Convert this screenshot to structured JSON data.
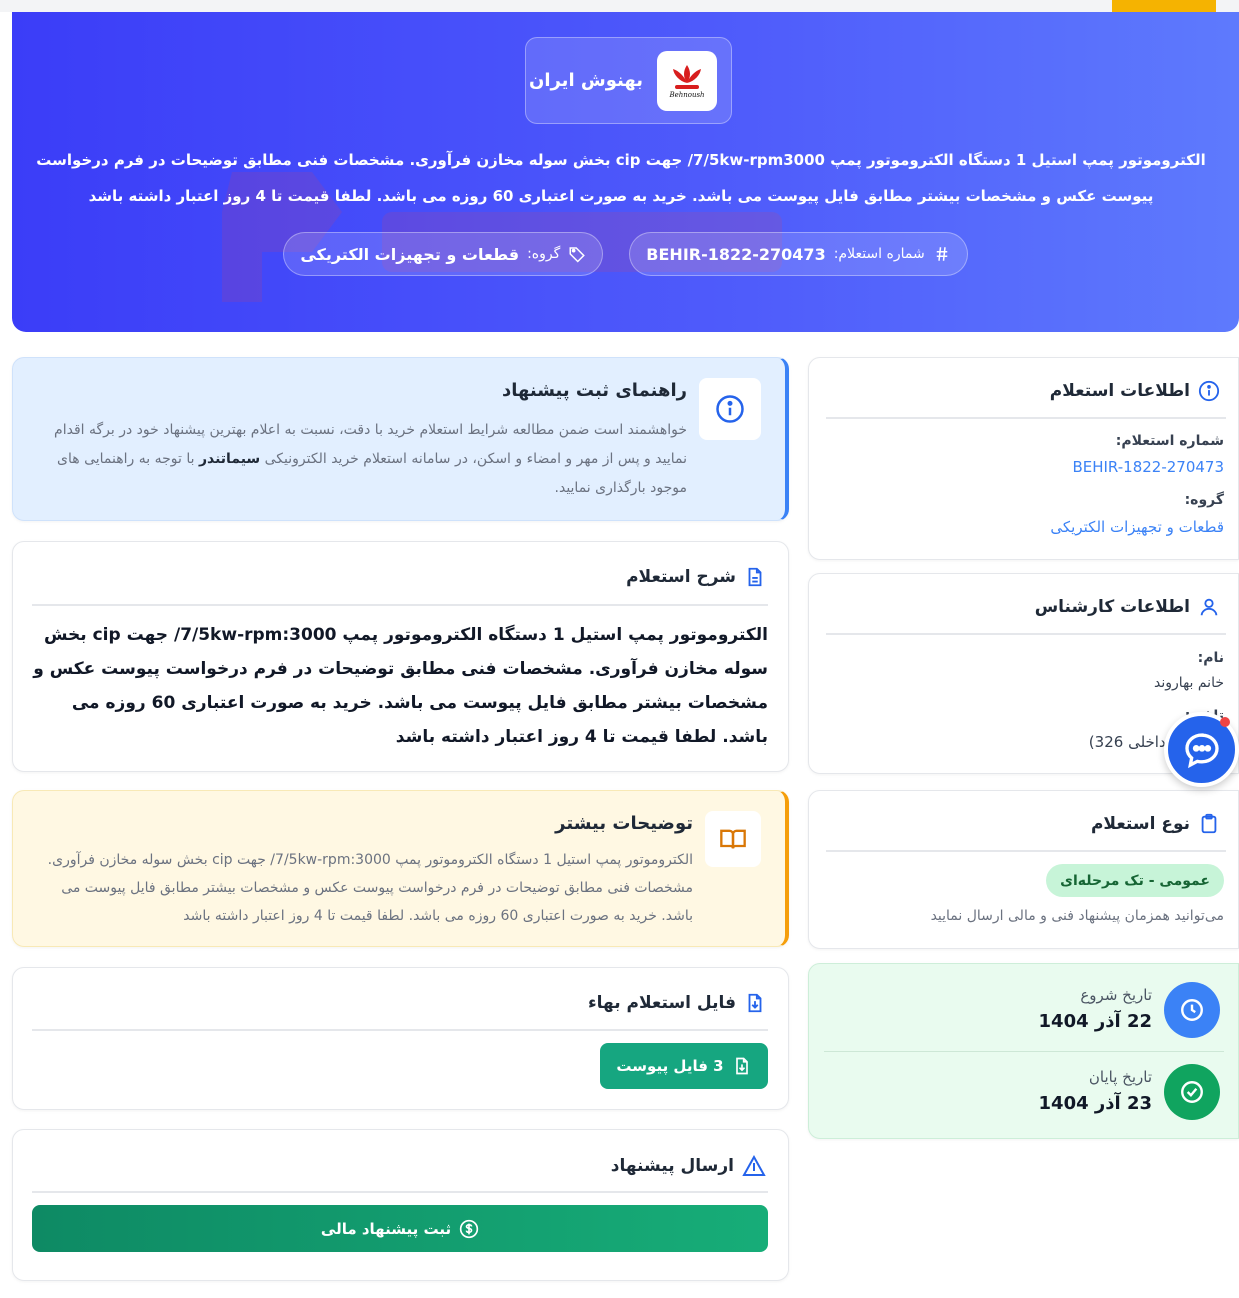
{
  "hero": {
    "org_name": "بهنوش ایران",
    "logo_text": "Behnoush",
    "description": "الکتروموتور پمپ استیل 1 دستگاه الکتروموتور پمپ 7/5kw-rpm3000/ جهت cip بخش سوله مخازن فرآوری. مشخصات فنی مطابق توضیحات در فرم درخواست پیوست عکس و مشخصات بیشتر مطابق فایل پیوست می باشد. خرید به صورت اعتباری 60 روزه می باشد. لطفا قیمت تا 4 روز اعتبار داشته باشد",
    "inquiry_label": "شماره استعلام:",
    "inquiry_value": "BEHIR-1822-270473",
    "group_label": "گروه:",
    "group_value": "قطعات و تجهیزات الکتریکی"
  },
  "guide": {
    "title": "راهنمای ثبت پیشنهاد",
    "text_before": "خواهشمند است ضمن مطالعه شرایط استعلام خرید با دقت، نسبت به اعلام بهترین پیشنهاد خود در برگه اقدام نمایید و پس از مهر و امضاء و اسکن، در سامانه استعلام خرید الکترونیکی ",
    "brand": "سیماتندر",
    "text_after": " با توجه به راهنمایی های موجود بارگذاری نمایید."
  },
  "description_card": {
    "title": "شرح استعلام",
    "body": "الکتروموتور پمپ استیل 1 دستگاه الکتروموتور پمپ 7/5kw-rpm:3000/ جهت cip بخش سوله مخازن فرآوری. مشخصات فنی مطابق توضیحات در فرم درخواست پیوست عکس و مشخصات بیشتر مطابق فایل پیوست می باشد. خرید به صورت اعتباری 60 روزه می باشد. لطفا قیمت تا 4 روز اعتبار داشته باشد"
  },
  "more_card": {
    "title": "توضیحات بیشتر",
    "body": "الکتروموتور پمپ استیل 1 دستگاه الکتروموتور پمپ 7/5kw-rpm:3000/ جهت cip بخش سوله مخازن فرآوری. مشخصات فنی مطابق توضیحات در فرم درخواست پیوست عکس و مشخصات بیشتر مطابق فایل پیوست می باشد. خرید به صورت اعتباری 60 روزه می باشد. لطفا قیمت تا 4 روز اعتبار داشته باشد"
  },
  "file_card": {
    "title": "فایل استعلام بهاء",
    "button_label": "3 فایل پیوست"
  },
  "send_card": {
    "title": "ارسال پیشنهاد",
    "button_label": "ثبت پیشنهاد مالی"
  },
  "info_card": {
    "title": "اطلاعات استعلام",
    "inquiry_label": "شماره استعلام:",
    "inquiry_value": "BEHIR-1822-270473",
    "group_label": "گروه:",
    "group_value": "قطعات و تجهیزات الکتریکی"
  },
  "expert_card": {
    "title": "اطلاعات کارشناس",
    "name_label": "نام:",
    "name_value": "خانم بهاروند",
    "phone_label": "تلفن:",
    "phone_value": "02144 (داخلی 326)"
  },
  "type_card": {
    "title": "نوع استعلام",
    "badge": "عمومی - تک مرحله‌ای",
    "note": "می‌توانید همزمان پیشنهاد فنی و مالی ارسال نمایید"
  },
  "dates_card": {
    "start_label": "تاریخ شروع",
    "start_value": "22 آذر 1404",
    "end_label": "تاریخ پایان",
    "end_value": "23 آذر 1404"
  },
  "colors": {
    "hero": "#4050fa",
    "success": "#16a680",
    "info": "#3b82f6",
    "warning": "#f59e0b"
  },
  "icons": {
    "inquiry": "hash-icon",
    "group": "tag-icon",
    "guide": "info-icon",
    "description": "document-icon",
    "more": "book-icon",
    "file": "file-download-icon",
    "send": "triangle-icon",
    "offer": "dollar-icon",
    "expert": "user-icon",
    "type": "clipboard-icon",
    "start": "clock-icon",
    "end": "check-circle-icon",
    "chat": "chat-icon"
  }
}
